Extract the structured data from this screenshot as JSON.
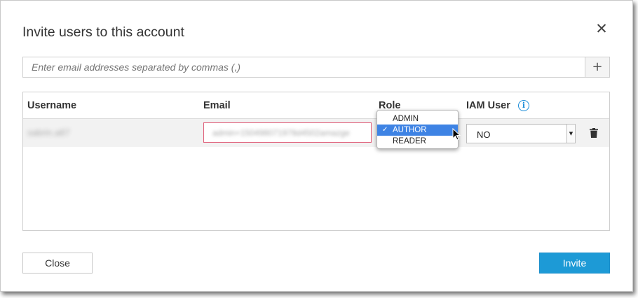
{
  "dialog": {
    "title": "Invite users to this account",
    "close_glyph": "✕"
  },
  "email_entry": {
    "placeholder": "Enter email addresses separated by commas (,)",
    "add_glyph": "+"
  },
  "table": {
    "headers": {
      "username": "Username",
      "email": "Email",
      "role": "Role",
      "iam_user": "IAM User"
    },
    "info_glyph": "i",
    "rows": [
      {
        "username": "sabrin.a87",
        "email": "admin+150498071978d4502amazge",
        "iam_user": "NO"
      }
    ]
  },
  "role_dropdown": {
    "options": [
      "ADMIN",
      "AUTHOR",
      "READER"
    ],
    "selected": "AUTHOR",
    "check_glyph": "✓"
  },
  "footer": {
    "close_label": "Close",
    "invite_label": "Invite"
  },
  "colors": {
    "accent": "#1d9ad6",
    "selected_option": "#3e83e4",
    "email_invalid_border": "#e0607a",
    "info_icon": "#1a8cd8"
  },
  "icons": {
    "close": "close-icon",
    "add": "plus-icon",
    "info": "info-icon",
    "delete": "trash-icon",
    "cursor": "mouse-pointer-icon"
  }
}
